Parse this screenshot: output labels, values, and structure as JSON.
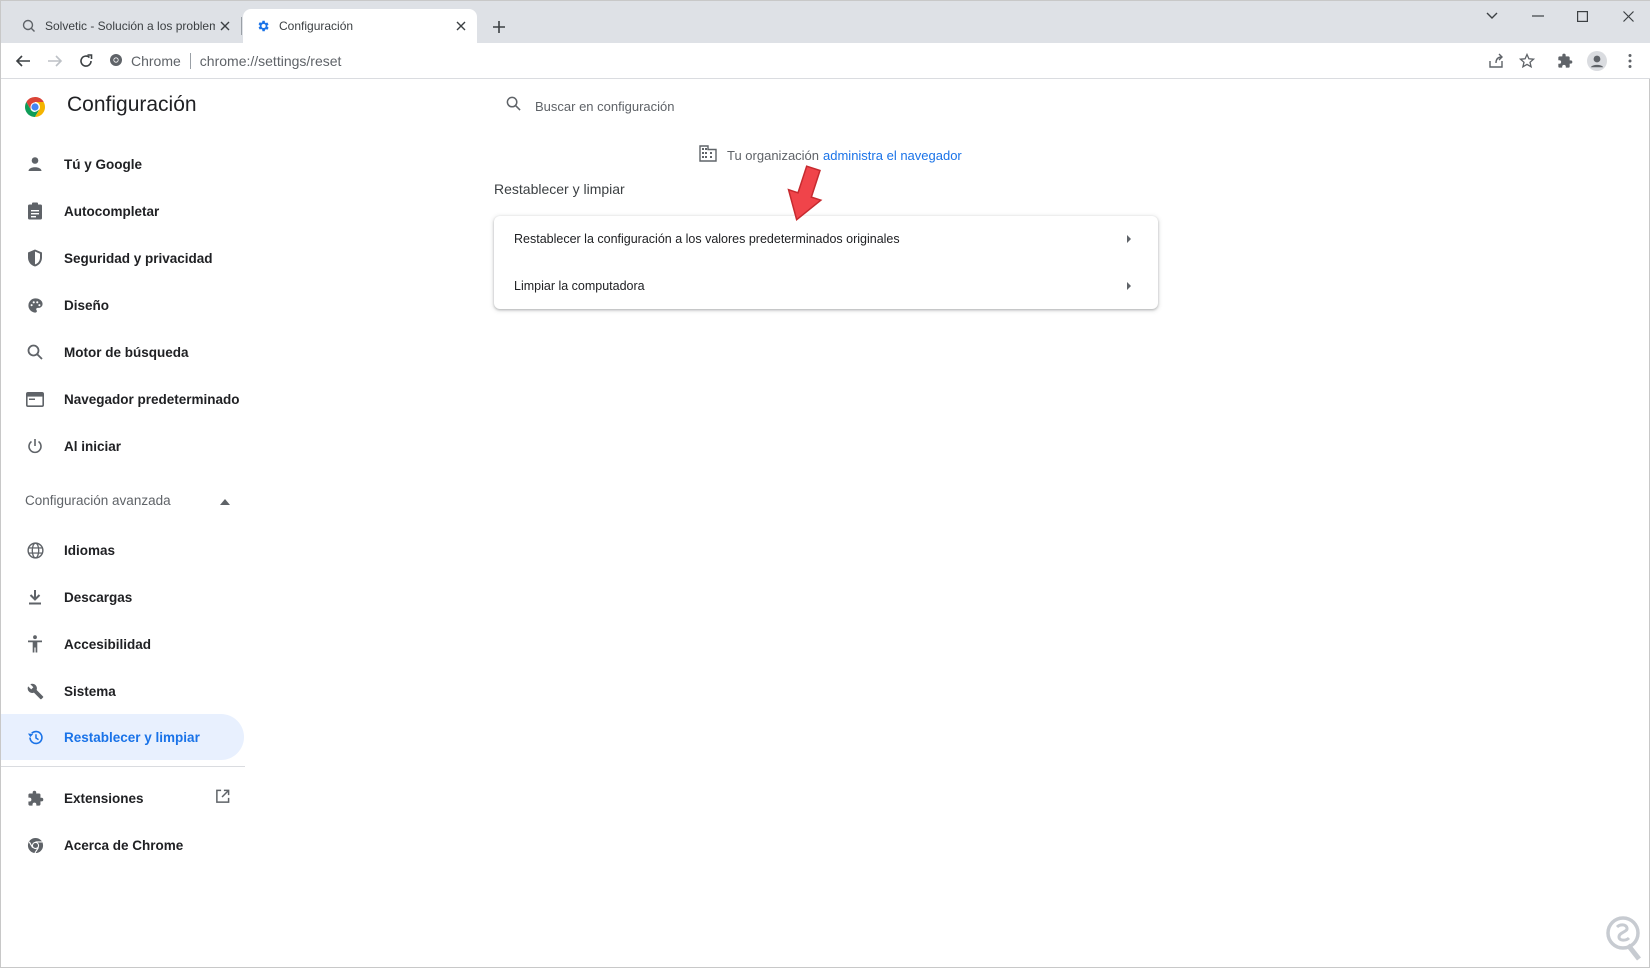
{
  "browser": {
    "tabs": [
      {
        "title": "Solvetic - Solución a los problemas",
        "active": false
      },
      {
        "title": "Configuración",
        "active": true
      }
    ],
    "omnibox": {
      "site_label": "Chrome",
      "url": "chrome://settings/reset"
    }
  },
  "settings": {
    "title": "Configuración",
    "search_placeholder": "Buscar en configuración",
    "sidebar": {
      "items": [
        {
          "label": "Tú y Google",
          "icon": "person-icon"
        },
        {
          "label": "Autocompletar",
          "icon": "clipboard-icon"
        },
        {
          "label": "Seguridad y privacidad",
          "icon": "shield-icon"
        },
        {
          "label": "Diseño",
          "icon": "palette-icon"
        },
        {
          "label": "Motor de búsqueda",
          "icon": "search-icon"
        },
        {
          "label": "Navegador predeterminado",
          "icon": "browser-window-icon"
        },
        {
          "label": "Al iniciar",
          "icon": "power-icon"
        }
      ],
      "advanced_label": "Configuración avanzada",
      "advanced_items": [
        {
          "label": "Idiomas",
          "icon": "globe-icon"
        },
        {
          "label": "Descargas",
          "icon": "download-icon"
        },
        {
          "label": "Accesibilidad",
          "icon": "accessibility-icon"
        },
        {
          "label": "Sistema",
          "icon": "wrench-icon"
        },
        {
          "label": "Restablecer y limpiar",
          "icon": "history-icon",
          "selected": true
        }
      ],
      "footer_items": [
        {
          "label": "Extensiones",
          "icon": "puzzle-icon"
        },
        {
          "label": "Acerca de Chrome",
          "icon": "chrome-icon"
        }
      ]
    },
    "managed": {
      "prefix": "Tu organización",
      "link": "administra el navegador"
    },
    "section": {
      "title": "Restablecer y limpiar",
      "rows": [
        {
          "label": "Restablecer la configuración a los valores predeterminados originales"
        },
        {
          "label": "Limpiar la computadora"
        }
      ]
    },
    "colors": {
      "accent": "#1a73e8",
      "selected_bg": "#e8f0fe",
      "annotation_arrow": "#f0444a"
    }
  }
}
